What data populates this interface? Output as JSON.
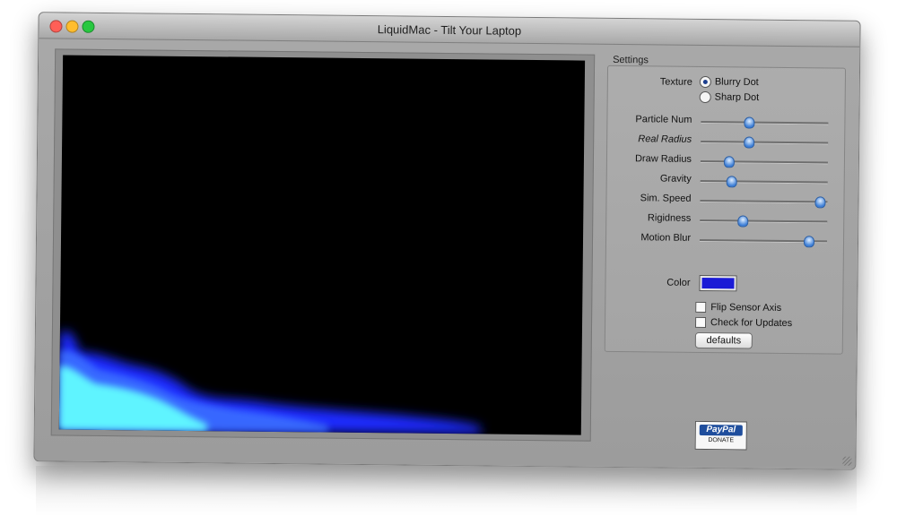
{
  "window": {
    "title": "LiquidMac - Tilt Your Laptop",
    "controls": [
      "close-button",
      "minimize-button",
      "zoom-button"
    ]
  },
  "settings": {
    "group_title": "Settings",
    "texture": {
      "label": "Texture",
      "options": [
        "Blurry Dot",
        "Sharp Dot"
      ],
      "selected": "Blurry Dot"
    },
    "sliders": [
      {
        "label": "Particle Num",
        "value": 0.37,
        "italic": false
      },
      {
        "label": "Real Radius",
        "value": 0.37,
        "italic": true
      },
      {
        "label": "Draw Radius",
        "value": 0.22,
        "italic": false
      },
      {
        "label": "Gravity",
        "value": 0.24,
        "italic": false
      },
      {
        "label": "Sim. Speed",
        "value": 0.94,
        "italic": false
      },
      {
        "label": "Rigidness",
        "value": 0.33,
        "italic": false
      },
      {
        "label": "Motion Blur",
        "value": 0.85,
        "italic": false
      }
    ],
    "color": {
      "label": "Color",
      "value": "#1b1bd6"
    },
    "checkboxes": [
      {
        "label": "Flip Sensor Axis",
        "checked": false
      },
      {
        "label": "Check for Updates",
        "checked": false
      }
    ],
    "defaults_button": "defaults"
  },
  "donate": {
    "logo": "PayPal",
    "label": "DONATE"
  },
  "colors": {
    "fluid_dark": "#1d2cff",
    "fluid_light": "#5ff4ff",
    "canvas_bg": "#000000"
  }
}
